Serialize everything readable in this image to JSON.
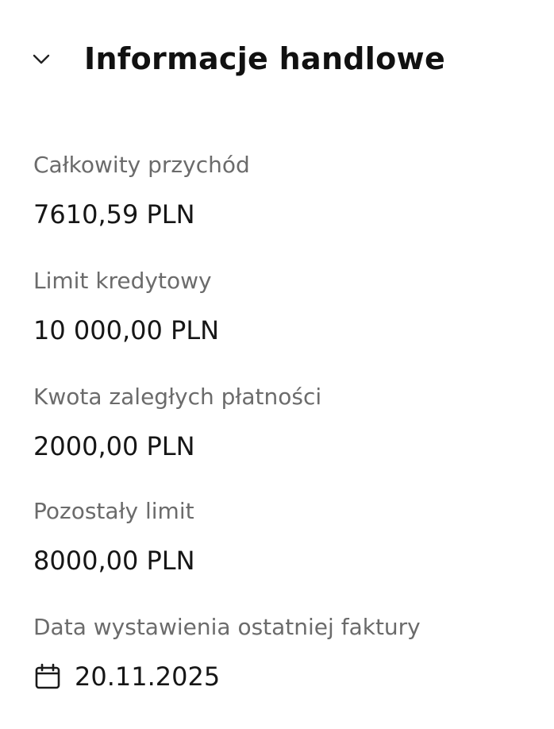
{
  "section": {
    "title": "Informacje handlowe",
    "toggle_icon": "chevron-down-icon"
  },
  "fields": [
    {
      "label": "Całkowity przychód",
      "value": "7610,59 PLN"
    },
    {
      "label": "Limit kredytowy",
      "value": "10 000,00 PLN"
    },
    {
      "label": "Kwota zaległych płatności",
      "value": "2000,00 PLN"
    },
    {
      "label": "Pozostały limit",
      "value": "8000,00 PLN"
    },
    {
      "label": "Data wystawienia ostatniej faktury",
      "value": "20.11.2025",
      "icon": "calendar-icon"
    }
  ],
  "colors": {
    "label": "#6b6b6b",
    "value": "#161616",
    "title": "#111111"
  }
}
